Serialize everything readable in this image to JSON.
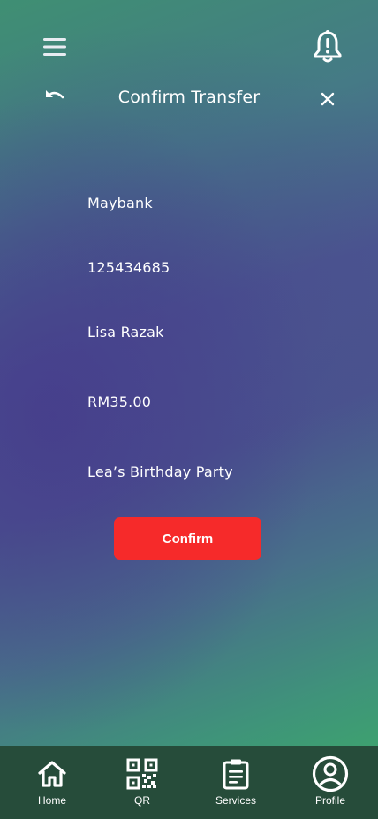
{
  "header": {
    "title": "Confirm Transfer",
    "menu_icon": "hamburger-menu-icon",
    "notification_icon": "bell-alert-icon",
    "back_icon": "undo-arrow-icon",
    "close_icon": "close-icon"
  },
  "transfer": {
    "bank": "Maybank",
    "account_number": "125434685",
    "recipient_name": "Lisa Razak",
    "amount": "RM35.00",
    "reference": "Lea’s Birthday Party"
  },
  "actions": {
    "confirm_label": "Confirm"
  },
  "bottom_nav": {
    "items": [
      {
        "label": "Home",
        "icon": "home-icon"
      },
      {
        "label": "QR",
        "icon": "qr-code-icon"
      },
      {
        "label": "Services",
        "icon": "clipboard-icon"
      },
      {
        "label": "Profile",
        "icon": "profile-icon"
      }
    ]
  },
  "colors": {
    "confirm_button": "#f62a2a",
    "bottom_nav_bg": "#264c3a",
    "gradient_green": "#3caf66",
    "gradient_purple": "#4b5590"
  }
}
